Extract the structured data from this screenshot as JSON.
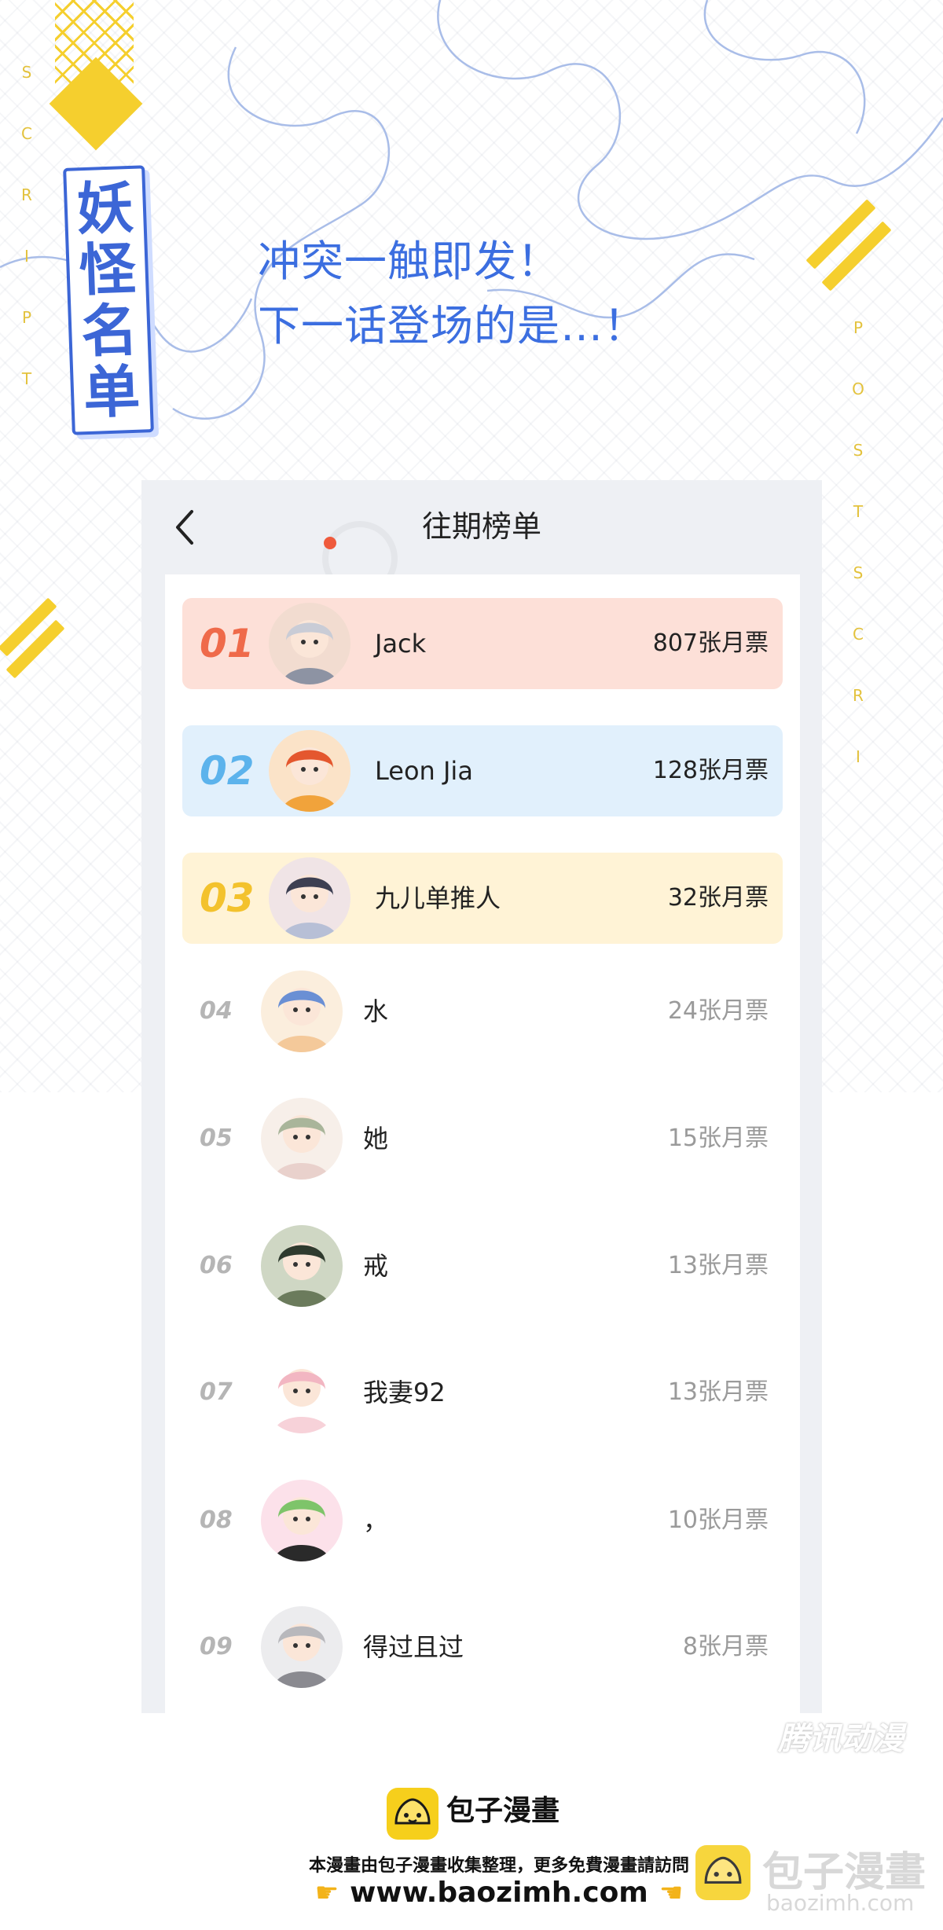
{
  "banner": {
    "logo_chars": [
      "妖",
      "怪",
      "名",
      "单"
    ],
    "left_letters": [
      "S",
      "C",
      "R",
      "I",
      "P",
      "T"
    ],
    "right_letters": [
      "P",
      "O",
      "S",
      "T",
      "S",
      "C",
      "R",
      "I"
    ],
    "headline_line1": "冲突一触即发！",
    "headline_line2": "下一话登场的是…！",
    "watermark": "腾讯动漫"
  },
  "app": {
    "title": "往期榜单",
    "back_icon": "chevron-left-icon"
  },
  "ranking": [
    {
      "rank": "01",
      "name": "Jack",
      "votes": "807张月票",
      "bg": "#fde0d8",
      "num_color": "#ef6a4a"
    },
    {
      "rank": "02",
      "name": "Leon Jia",
      "votes": "128张月票",
      "bg": "#e1f0fc",
      "num_color": "#5cb3ec"
    },
    {
      "rank": "03",
      "name": "九儿单推人",
      "votes": "32张月票",
      "bg": "#fff3d6",
      "num_color": "#f3c22d"
    },
    {
      "rank": "04",
      "name": "水",
      "votes": "24张月票"
    },
    {
      "rank": "05",
      "name": "她",
      "votes": "15张月票"
    },
    {
      "rank": "06",
      "name": "戒",
      "votes": "13张月票"
    },
    {
      "rank": "07",
      "name": "我妻92",
      "votes": "13张月票"
    },
    {
      "rank": "08",
      "name": "，",
      "votes": "10张月票"
    },
    {
      "rank": "09",
      "name": "得过且过",
      "votes": "8张月票"
    }
  ],
  "footer": {
    "brand": "包子漫畫",
    "notice": "本漫畫由包子漫畫收集整理，更多免費漫畫請訪問",
    "url": "www.baozimh.com",
    "watermark_brand": "包子漫畫",
    "watermark_url": "baozimh.com"
  },
  "colors": {
    "accent_blue": "#3b6ee0",
    "accent_yellow": "#f5cf2e"
  }
}
